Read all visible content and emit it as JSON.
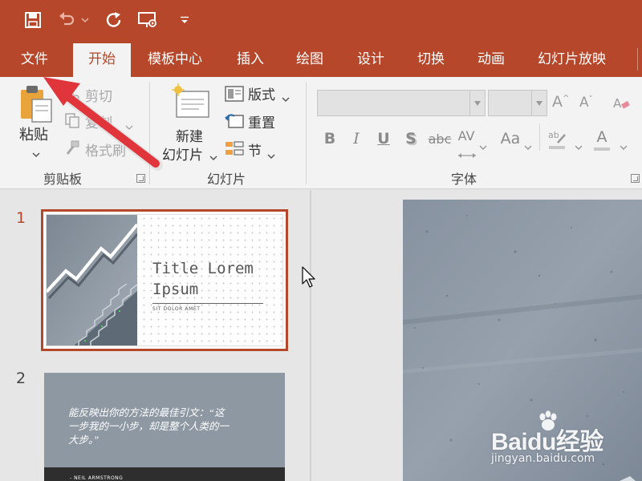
{
  "quick_access": {
    "save": "save-icon",
    "undo": "undo-icon",
    "redo": "redo-icon",
    "present": "slideshow-icon",
    "customize": "customize-dropdown-icon"
  },
  "tabs": [
    {
      "label": "文件",
      "active": false
    },
    {
      "label": "开始",
      "active": true
    },
    {
      "label": "模板中心",
      "active": false
    },
    {
      "label": "插入",
      "active": false
    },
    {
      "label": "绘图",
      "active": false
    },
    {
      "label": "设计",
      "active": false
    },
    {
      "label": "切换",
      "active": false
    },
    {
      "label": "动画",
      "active": false
    },
    {
      "label": "幻灯片放映",
      "active": false
    }
  ],
  "ribbon": {
    "clipboard": {
      "paste": "粘贴",
      "cut": "剪切",
      "copy": "复制",
      "format_painter": "格式刷",
      "group_label": "剪贴板"
    },
    "slides": {
      "new_slide_line1": "新建",
      "new_slide_line2": "幻灯片",
      "layout": "版式",
      "reset": "重置",
      "section": "节",
      "group_label": "幻灯片"
    },
    "font": {
      "group_label": "字体",
      "font_name": "",
      "font_size": "",
      "bold": "B",
      "italic": "I",
      "underline": "U",
      "shadow": "S",
      "strikethrough": "abc",
      "spacing": "AV",
      "change_case": "Aa",
      "font_color": "A"
    }
  },
  "slides": [
    {
      "number": "1",
      "selected": true,
      "title": "Title Lorem Ipsum",
      "title_line1": "Title Lorem",
      "title_line2": "Ipsum",
      "subtitle": "SIT DOLOR AMET"
    },
    {
      "number": "2",
      "selected": false,
      "quote_line1": "能反映出你的方法的最佳引文：“这",
      "quote_line2": "一步我的一小步，却是整个人类的一",
      "quote_line3": "大步。”",
      "author": "- NEIL ARMSTRONG"
    }
  ],
  "watermark": {
    "brand": "Baidu经验",
    "url": "jingyan.baidu.com"
  },
  "colors": {
    "accent": "#b7472a",
    "ribbon_bg": "#f3f3f3",
    "workspace_bg": "#e6e6e6",
    "annotation_arrow": "#e0353a"
  }
}
